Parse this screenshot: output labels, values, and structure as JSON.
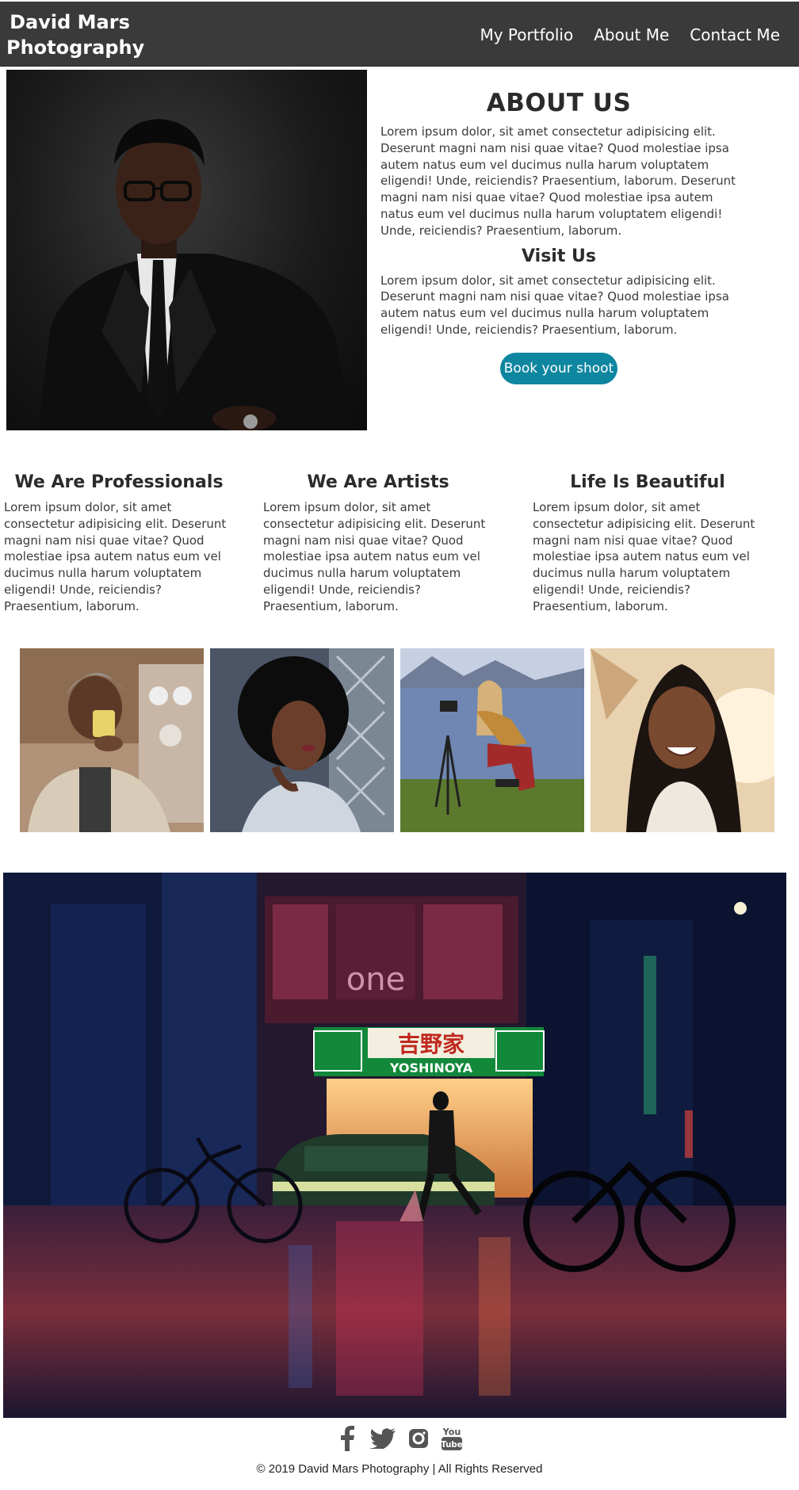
{
  "header": {
    "brand": "David Mars Photography",
    "nav": [
      "My Portfolio",
      "About Me",
      "Contact Me"
    ]
  },
  "about": {
    "title": "ABOUT US",
    "text1": "Lorem ipsum dolor, sit amet consectetur adipisicing elit. Deserunt magni nam nisi quae vitae? Quod molestiae ipsa autem natus eum vel ducimus nulla harum voluptatem eligendi! Unde, reiciendis? Praesentium, laborum. Deserunt magni nam nisi quae vitae? Quod molestiae ipsa autem natus eum vel ducimus nulla harum voluptatem eligendi! Unde, reiciendis? Praesentium, laborum.",
    "visit_title": "Visit Us",
    "text2": "Lorem ipsum dolor, sit amet consectetur adipisicing elit. Deserunt magni nam nisi quae vitae? Quod molestiae ipsa autem natus eum vel ducimus nulla harum voluptatem eligendi! Unde, reiciendis? Praesentium, laborum.",
    "button": "Book your shoot"
  },
  "features": [
    {
      "title": "We Are Professionals",
      "text": "Lorem ipsum dolor, sit amet consectetur adipisicing elit. Deserunt magni nam nisi quae vitae? Quod molestiae ipsa autem natus eum vel ducimus nulla harum voluptatem eligendi! Unde, reiciendis? Praesentium, laborum."
    },
    {
      "title": "We Are Artists",
      "text": "Lorem ipsum dolor, sit amet consectetur adipisicing elit. Deserunt magni nam nisi quae vitae? Quod molestiae ipsa autem natus eum vel ducimus nulla harum voluptatem eligendi! Unde, reiciendis? Praesentium, laborum."
    },
    {
      "title": "Life Is Beautiful",
      "text": "Lorem ipsum dolor, sit amet consectetur adipisicing elit. Deserunt magni nam nisi quae vitae? Quod molestiae ipsa autem natus eum vel ducimus nulla harum voluptatem eligendi! Unde, reiciendis? Praesentium, laborum."
    }
  ],
  "street_sign": {
    "brand_jp": "吉野家",
    "brand": "YOSHINOYA",
    "neon": "one"
  },
  "footer": {
    "icons": [
      "facebook-icon",
      "twitter-icon",
      "instagram-icon",
      "youtube-icon"
    ],
    "youtube_top": "You",
    "youtube_bottom": "Tube",
    "copyright": "© 2019 David Mars Photography | All Rights Reserved"
  },
  "colors": {
    "navbar": "#3a3a3a",
    "button": "#0f86a0",
    "footer_icons": "#555555"
  }
}
